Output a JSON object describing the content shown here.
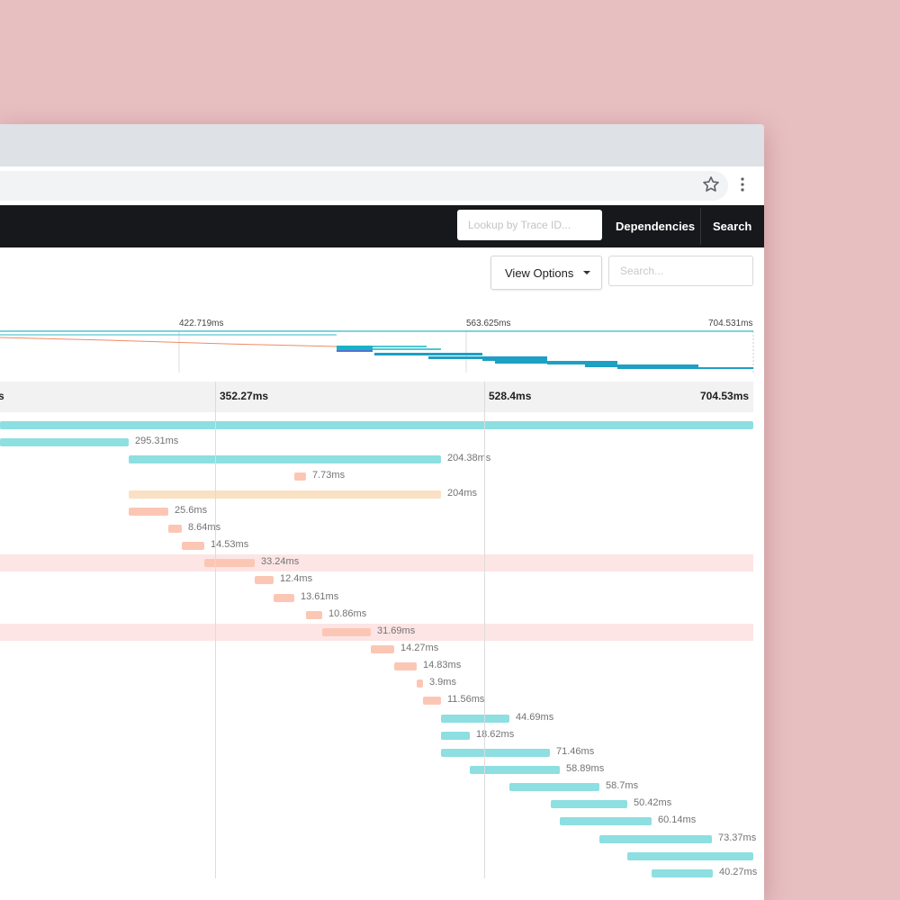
{
  "browser": {
    "star_icon": "star-icon",
    "menu_icon": "kebab-menu-icon"
  },
  "nav": {
    "lookup_placeholder": "Lookup by Trace ID...",
    "dependencies_label": "Dependencies",
    "search_label": "Search"
  },
  "controls": {
    "view_options_label": "View Options",
    "search_placeholder": "Search..."
  },
  "minimap": {
    "ticks": [
      "422.719ms",
      "563.625ms",
      "704.531ms"
    ]
  },
  "timeline": {
    "ruler": [
      "s",
      "352.27ms",
      "528.4ms",
      "704.53ms"
    ]
  },
  "colors": {
    "service_a": "#8ddfe1",
    "service_b": "#fbc7b4",
    "service_c": "#fae1c3",
    "highlight_row": "#fde5e5",
    "navbar": "#16181c",
    "page_background": "#e8bfc1"
  },
  "spans": [
    {
      "duration": "",
      "color": "teal",
      "highlighted": false
    },
    {
      "duration": "295.31ms",
      "color": "teal",
      "highlighted": false
    },
    {
      "duration": "204.38ms",
      "color": "teal",
      "highlighted": false
    },
    {
      "duration": "7.73ms",
      "color": "salmon",
      "highlighted": false
    },
    {
      "duration": "204ms",
      "color": "peach",
      "highlighted": false
    },
    {
      "duration": "25.6ms",
      "color": "salmon",
      "highlighted": false
    },
    {
      "duration": "8.64ms",
      "color": "salmon",
      "highlighted": false
    },
    {
      "duration": "14.53ms",
      "color": "salmon",
      "highlighted": false
    },
    {
      "duration": "33.24ms",
      "color": "salmon",
      "highlighted": true
    },
    {
      "duration": "12.4ms",
      "color": "salmon",
      "highlighted": false
    },
    {
      "duration": "13.61ms",
      "color": "salmon",
      "highlighted": false
    },
    {
      "duration": "10.86ms",
      "color": "salmon",
      "highlighted": false
    },
    {
      "duration": "31.69ms",
      "color": "salmon",
      "highlighted": true
    },
    {
      "duration": "14.27ms",
      "color": "salmon",
      "highlighted": false
    },
    {
      "duration": "14.83ms",
      "color": "salmon",
      "highlighted": false
    },
    {
      "duration": "3.9ms",
      "color": "salmon",
      "highlighted": false
    },
    {
      "duration": "11.56ms",
      "color": "salmon",
      "highlighted": false
    },
    {
      "duration": "44.69ms",
      "color": "teal",
      "highlighted": false
    },
    {
      "duration": "18.62ms",
      "color": "teal",
      "highlighted": false
    },
    {
      "duration": "71.46ms",
      "color": "teal",
      "highlighted": false
    },
    {
      "duration": "58.89ms",
      "color": "teal",
      "highlighted": false
    },
    {
      "duration": "58.7ms",
      "color": "teal",
      "highlighted": false
    },
    {
      "duration": "50.42ms",
      "color": "teal",
      "highlighted": false
    },
    {
      "duration": "60.14ms",
      "color": "teal",
      "highlighted": false
    },
    {
      "duration": "73.37ms",
      "color": "teal",
      "highlighted": false
    },
    {
      "duration": "",
      "color": "teal",
      "highlighted": false
    },
    {
      "duration": "40.27ms",
      "color": "teal",
      "highlighted": false
    }
  ]
}
